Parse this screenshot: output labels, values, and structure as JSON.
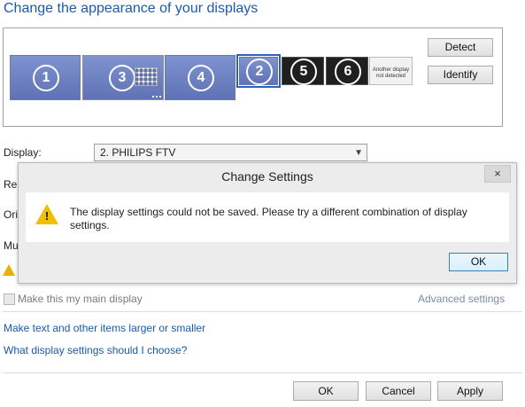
{
  "page": {
    "title": "Change the appearance of your displays"
  },
  "arrangement": {
    "monitors": [
      {
        "number": "1"
      },
      {
        "number": "3"
      },
      {
        "number": "4"
      },
      {
        "number": "2"
      },
      {
        "number": "5"
      },
      {
        "number": "6"
      }
    ],
    "not_detected_label": "Another display not detected"
  },
  "buttons": {
    "detect": "Detect",
    "identify": "Identify",
    "ok": "OK",
    "cancel": "Cancel",
    "apply": "Apply"
  },
  "display": {
    "label": "Display:",
    "value": "2. PHILIPS FTV"
  },
  "hidden_labels": {
    "resolution": "Res",
    "orientation": "Ori",
    "multiple": "Mu"
  },
  "main_display": {
    "label": "Make this my main display",
    "checked": false
  },
  "advanced_settings": "Advanced settings",
  "links": {
    "text_size": "Make text and other items larger or smaller",
    "what_settings": "What display settings should I choose?"
  },
  "dialog": {
    "title": "Change Settings",
    "close": "×",
    "message": "The display settings could not be saved.  Please try a different combination of display settings.",
    "ok": "OK",
    "warning_mark": "!"
  },
  "colors": {
    "accent": "#1e5aa8",
    "monitor": "#6b7fc2",
    "warning": "#f0c000"
  }
}
